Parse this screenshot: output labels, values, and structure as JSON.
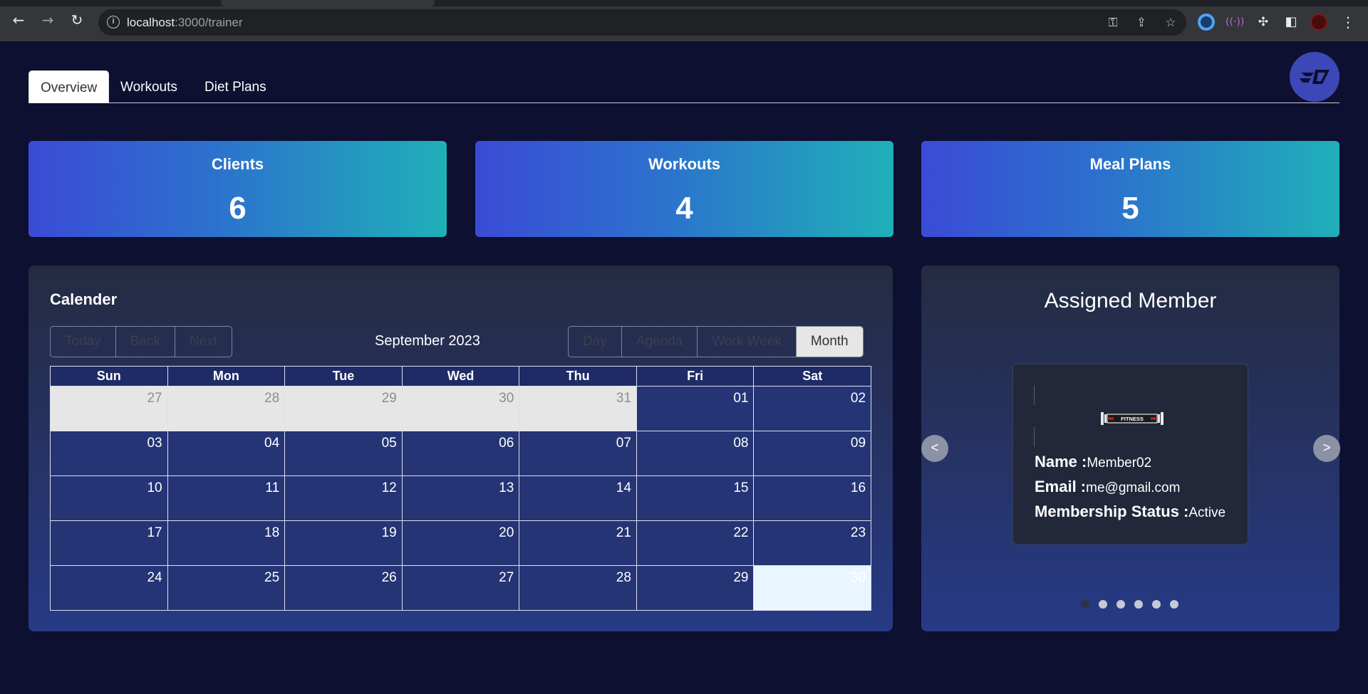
{
  "browser": {
    "url_host": "localhost",
    "url_rest": ":3000/trainer"
  },
  "nav": {
    "tabs": [
      {
        "label": "Overview",
        "active": true
      },
      {
        "label": "Workouts",
        "active": false
      },
      {
        "label": "Diet Plans",
        "active": false
      }
    ]
  },
  "stats": [
    {
      "label": "Clients",
      "value": "6"
    },
    {
      "label": "Workouts",
      "value": "4"
    },
    {
      "label": "Meal Plans",
      "value": "5"
    }
  ],
  "calendar": {
    "title": "Calender",
    "month_label": "September 2023",
    "nav_buttons": [
      "Today",
      "Back",
      "Next"
    ],
    "view_buttons": [
      "Day",
      "Agenda",
      "Work Week",
      "Month"
    ],
    "selected_view": "Month",
    "weekdays": [
      "Sun",
      "Mon",
      "Tue",
      "Wed",
      "Thu",
      "Fri",
      "Sat"
    ],
    "weeks": [
      [
        {
          "d": "27",
          "off": true
        },
        {
          "d": "28",
          "off": true
        },
        {
          "d": "29",
          "off": true
        },
        {
          "d": "30",
          "off": true
        },
        {
          "d": "31",
          "off": true
        },
        {
          "d": "01"
        },
        {
          "d": "02"
        }
      ],
      [
        {
          "d": "03"
        },
        {
          "d": "04"
        },
        {
          "d": "05"
        },
        {
          "d": "06"
        },
        {
          "d": "07"
        },
        {
          "d": "08"
        },
        {
          "d": "09"
        }
      ],
      [
        {
          "d": "10"
        },
        {
          "d": "11"
        },
        {
          "d": "12"
        },
        {
          "d": "13"
        },
        {
          "d": "14"
        },
        {
          "d": "15"
        },
        {
          "d": "16"
        }
      ],
      [
        {
          "d": "17"
        },
        {
          "d": "18"
        },
        {
          "d": "19"
        },
        {
          "d": "20"
        },
        {
          "d": "21"
        },
        {
          "d": "22"
        },
        {
          "d": "23"
        }
      ],
      [
        {
          "d": "24"
        },
        {
          "d": "25"
        },
        {
          "d": "26"
        },
        {
          "d": "27"
        },
        {
          "d": "28"
        },
        {
          "d": "29"
        },
        {
          "d": "30",
          "today": true
        }
      ]
    ]
  },
  "assigned_member": {
    "title": "Assigned Member",
    "logo_text": "FITNESS",
    "name_label": "Name :",
    "name": "Member02",
    "email_label": "Email :",
    "email": "me@gmail.com",
    "status_label": "Membership Status :",
    "status": "Active",
    "prev_label": "<",
    "next_label": ">",
    "slides": 6,
    "active_slide": 0
  },
  "colors": {
    "page_bg": "#0d1030",
    "card_gradient_start": "#3a4bd6",
    "card_gradient_end": "#1fb0b8",
    "panel_bg": "#252b41",
    "calendar_cell": "#253475",
    "today_cell": "#eaf6ff"
  }
}
